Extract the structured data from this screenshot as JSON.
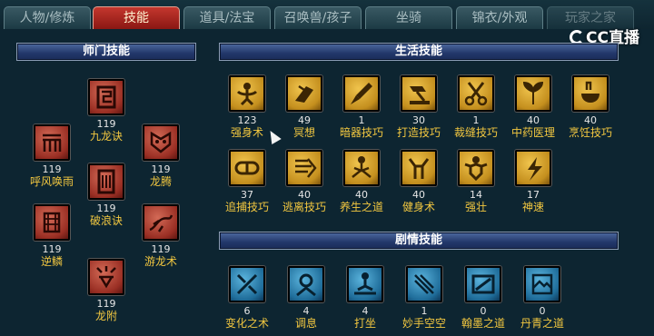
{
  "tabs": [
    {
      "label": "人物/修炼",
      "active": false
    },
    {
      "label": "技能",
      "active": true
    },
    {
      "label": "道具/法宝",
      "active": false
    },
    {
      "label": "召唤兽/孩子",
      "active": false
    },
    {
      "label": "坐骑",
      "active": false
    },
    {
      "label": "锦衣/外观",
      "active": false
    },
    {
      "label": "玩家之家",
      "active": false
    }
  ],
  "watermark": "CC直播",
  "sections": {
    "school": {
      "title": "师门技能"
    },
    "life": {
      "title": "生活技能"
    },
    "story": {
      "title": "剧情技能"
    }
  },
  "school_skills": [
    {
      "name": "九龙诀",
      "level": "119"
    },
    {
      "name": "呼风唤雨",
      "level": "119"
    },
    {
      "name": "龙腾",
      "level": "119"
    },
    {
      "name": "破浪诀",
      "level": "119"
    },
    {
      "name": "逆鳞",
      "level": "119"
    },
    {
      "name": "游龙术",
      "level": "119"
    },
    {
      "name": "龙附",
      "level": "119"
    }
  ],
  "life_skills": [
    {
      "name": "强身术",
      "level": "123"
    },
    {
      "name": "冥想",
      "level": "49"
    },
    {
      "name": "暗器技巧",
      "level": "1"
    },
    {
      "name": "打造技巧",
      "level": "30"
    },
    {
      "name": "裁缝技巧",
      "level": "1"
    },
    {
      "name": "中药医理",
      "level": "40"
    },
    {
      "name": "烹饪技巧",
      "level": "40"
    },
    {
      "name": "追捕技巧",
      "level": "37"
    },
    {
      "name": "逃离技巧",
      "level": "40"
    },
    {
      "name": "养生之道",
      "level": "40"
    },
    {
      "name": "健身术",
      "level": "40"
    },
    {
      "name": "强壮",
      "level": "14"
    },
    {
      "name": "神速",
      "level": "17"
    }
  ],
  "story_skills": [
    {
      "name": "变化之术",
      "level": "6"
    },
    {
      "name": "调息",
      "level": "4"
    },
    {
      "name": "打坐",
      "level": "4"
    },
    {
      "name": "妙手空空",
      "level": "1"
    },
    {
      "name": "翰墨之道",
      "level": "0"
    },
    {
      "name": "丹青之道",
      "level": "0"
    }
  ],
  "colors": {
    "background": "#0d2531",
    "skill_name": "#f2c740",
    "active_tab": "#b02a22",
    "header": "#2c427a"
  }
}
